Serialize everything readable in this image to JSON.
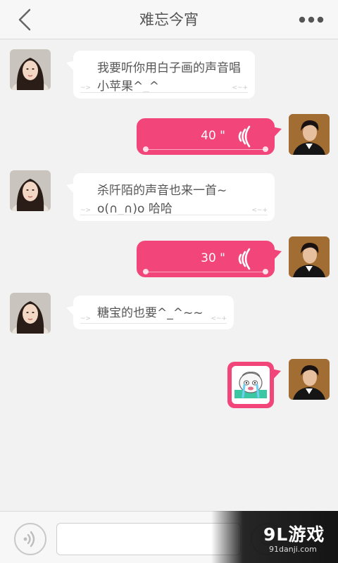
{
  "header": {
    "title": "难忘今宵",
    "back_icon": "chevron-left-icon",
    "more_icon": "more-dots-icon"
  },
  "messages": [
    {
      "side": "left",
      "type": "text",
      "lines": [
        "我要听你用白子画的声音唱",
        "小苹果^_^"
      ],
      "deco_left": "~>",
      "deco_right": "<~+"
    },
    {
      "side": "right",
      "type": "voice",
      "duration": "40 \""
    },
    {
      "side": "left",
      "type": "text",
      "lines": [
        "杀阡陌的声音也来一首~",
        "o(∩_∩)o 哈哈"
      ],
      "deco_left": "~>",
      "deco_right": "<~+"
    },
    {
      "side": "right",
      "type": "voice",
      "duration": "30 \""
    },
    {
      "side": "left",
      "type": "text",
      "lines": [
        "糖宝的也要^_^~~"
      ],
      "deco_left": "~>",
      "deco_right": "<~+"
    },
    {
      "side": "right",
      "type": "sticker",
      "sticker_icon": "crying-sticker-icon"
    }
  ],
  "input_bar": {
    "voice_toggle_icon": "voice-toggle-icon",
    "input_value": "",
    "emoji_icon": "emoji-icon"
  },
  "watermark": {
    "main": "9L游戏",
    "sub": "91danji.com"
  },
  "colors": {
    "accent_pink": "#f2457a",
    "background": "#f2f2f2",
    "bubble_white": "#ffffff"
  }
}
